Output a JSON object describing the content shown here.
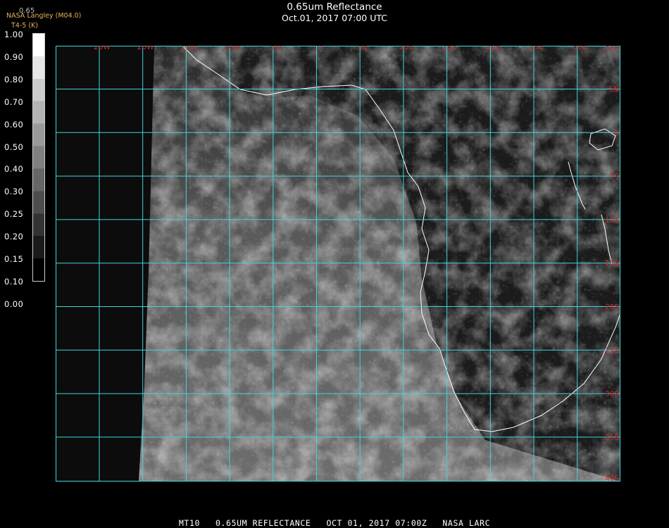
{
  "header": {
    "title": "0.65um Reflectance",
    "subtitle": "Oct.01, 2017 07:00 UTC"
  },
  "credits": {
    "line1": "NASA Langley (M04.0)",
    "line2": "T4-5 (K)",
    "band": "0.65"
  },
  "colorbar": {
    "labels": [
      "1.00",
      "0.90",
      "0.80",
      "0.70",
      "0.60",
      "0.50",
      "0.40",
      "0.30",
      "0.25",
      "0.20",
      "0.15",
      "0.10",
      "0.00"
    ]
  },
  "map": {
    "longitude_labels": [
      "25W",
      "20W",
      "15W",
      "10W",
      "5W",
      "0",
      "5E",
      "10E",
      "15E",
      "20E",
      "25E",
      "30E",
      "35E"
    ],
    "latitude_labels": [
      "5N",
      "0",
      "5S",
      "10S",
      "15S",
      "20S",
      "25S",
      "30S",
      "35S",
      "40S"
    ],
    "grid_color": "#3fd6dd",
    "label_color": "#d22a2a",
    "coast_color": "#ffffff"
  },
  "footer": {
    "satellite": "MT10",
    "product": "0.65UM REFLECTANCE",
    "datetime": "OCT 01, 2017 07:00Z",
    "source": "NASA LARC"
  }
}
